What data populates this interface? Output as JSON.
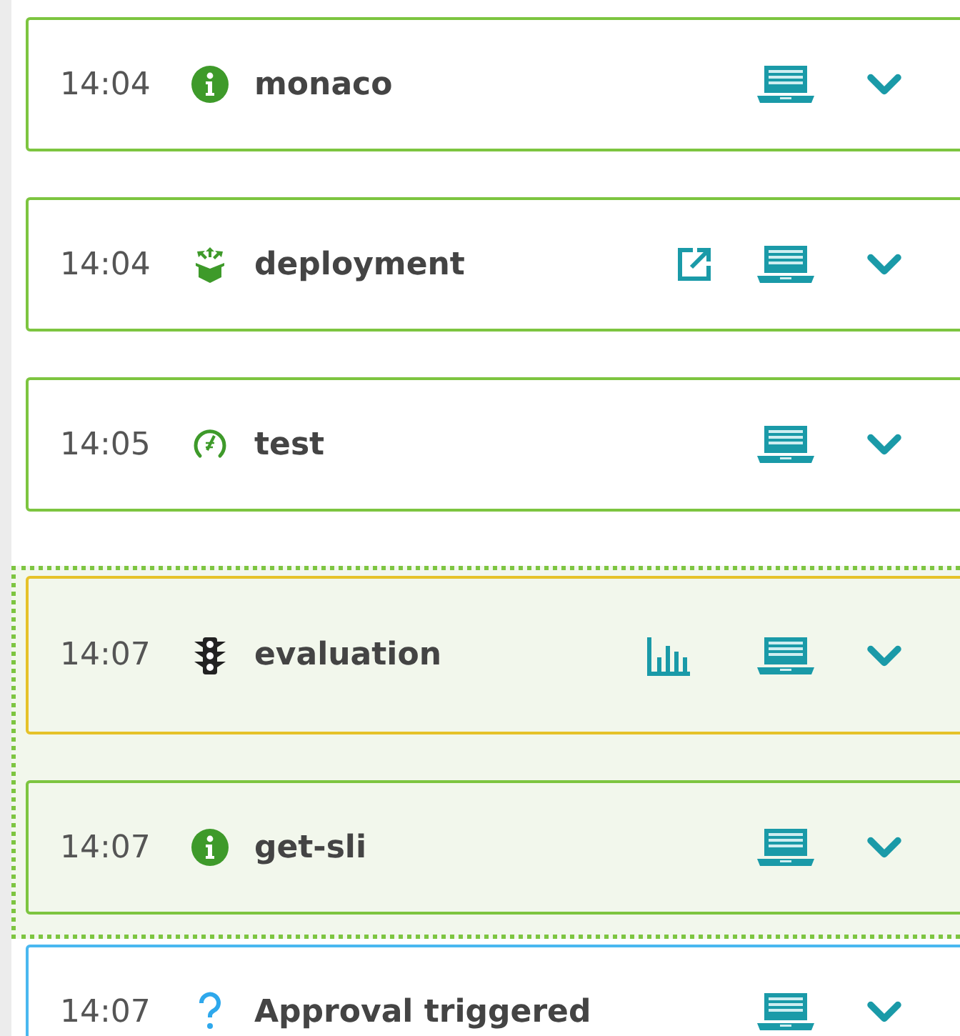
{
  "events": [
    {
      "time": "14:04",
      "name": "monaco",
      "kind": "info",
      "color": "#7dc540",
      "grouped": false,
      "link": false,
      "chart": false
    },
    {
      "time": "14:04",
      "name": "deployment",
      "kind": "deployment",
      "color": "#7dc540",
      "grouped": false,
      "link": true,
      "chart": false
    },
    {
      "time": "14:05",
      "name": "test",
      "kind": "test",
      "color": "#7dc540",
      "grouped": false,
      "link": false,
      "chart": false
    },
    {
      "time": "14:07",
      "name": "evaluation",
      "kind": "evaluation",
      "color": "#e6c229",
      "grouped": true,
      "link": false,
      "chart": true
    },
    {
      "time": "14:07",
      "name": "get-sli",
      "kind": "info",
      "color": "#7dc540",
      "grouped": true,
      "link": false,
      "chart": false
    },
    {
      "time": "14:07",
      "name": "Approval triggered",
      "kind": "question",
      "color": "#4ab8f0",
      "grouped": false,
      "link": false,
      "chart": false
    }
  ]
}
